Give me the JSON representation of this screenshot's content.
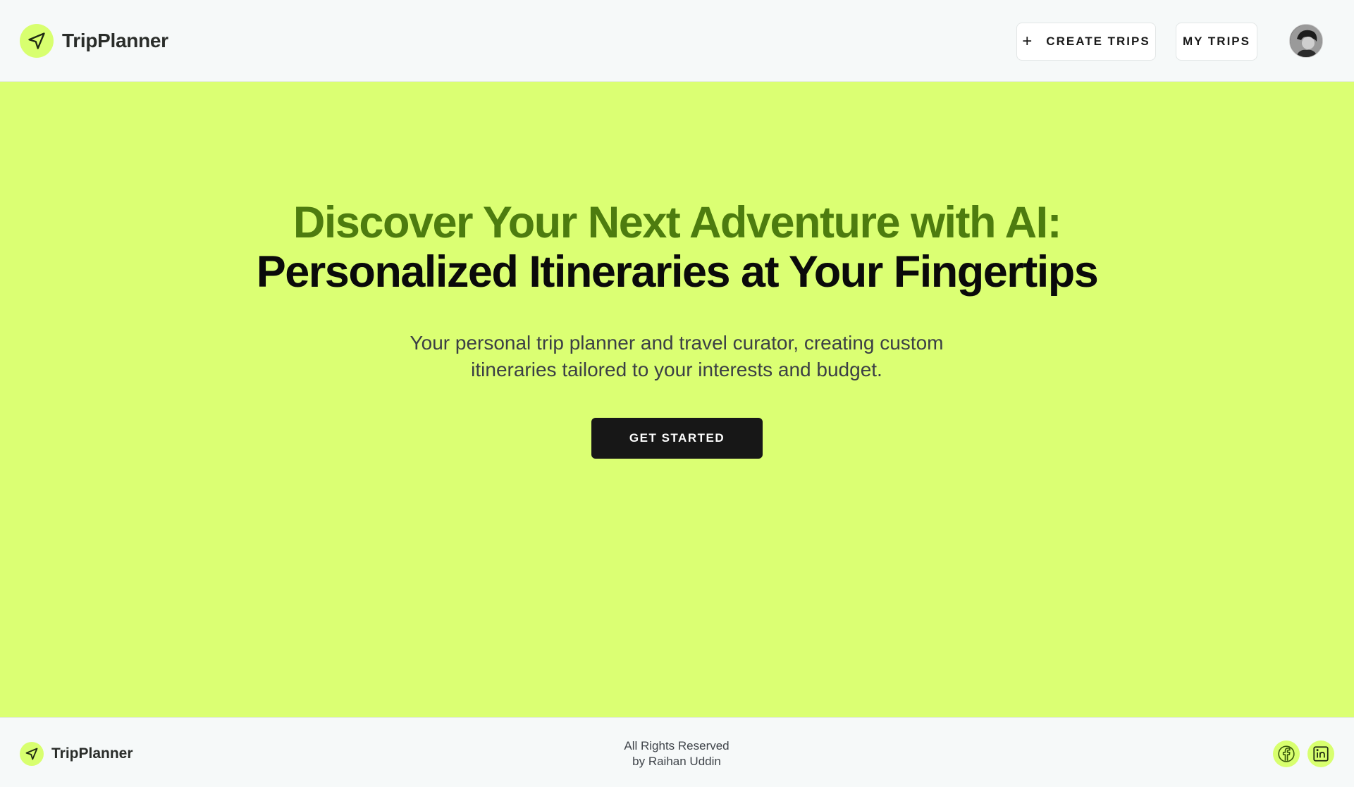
{
  "header": {
    "brand_name": "TripPlanner",
    "create_trips_label": "CREATE TRIPS",
    "my_trips_label": "MY TRIPS",
    "icons": {
      "logo": "navigation-arrow-icon",
      "create": "plus-icon",
      "avatar": "user-avatar"
    }
  },
  "hero": {
    "title_line1": "Discover Your Next Adventure with AI:",
    "title_line2": "Personalized Itineraries at Your Fingertips",
    "subtitle_line1": "Your personal trip planner and travel curator, creating custom",
    "subtitle_line2": "itineraries tailored to your interests and budget.",
    "cta_label": "GET STARTED"
  },
  "footer": {
    "brand_name": "TripPlanner",
    "rights_line1": "All Rights Reserved",
    "rights_line2": "by Raihan Uddin",
    "icons": {
      "facebook": "facebook-icon",
      "linkedin": "linkedin-icon"
    }
  },
  "colors": {
    "accent_lime": "#dbff73",
    "title_green": "#4d7c0f",
    "dark": "#171717",
    "header_bg": "#f6f9f9"
  }
}
